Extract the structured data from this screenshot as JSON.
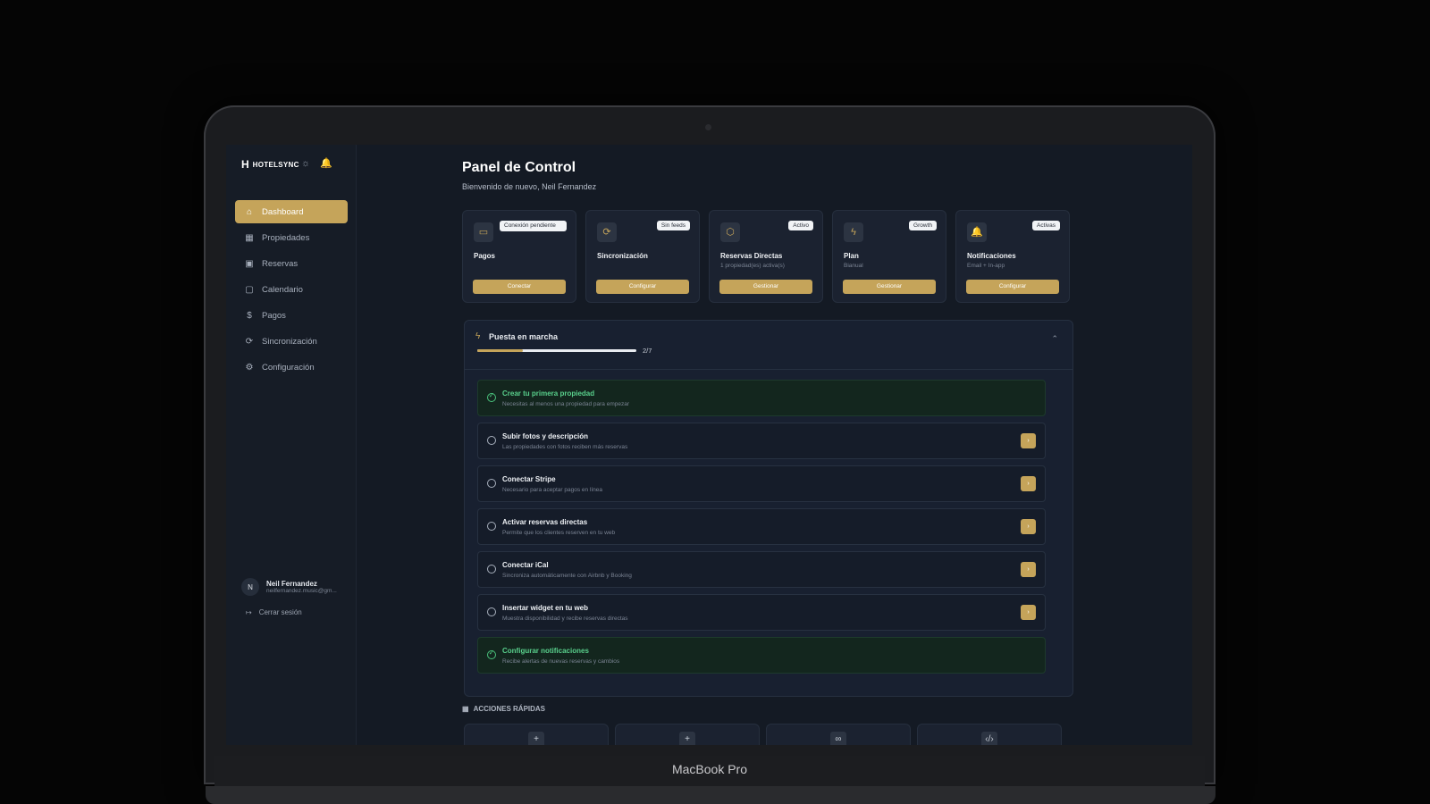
{
  "device": {
    "label": "MacBook Pro"
  },
  "brand": {
    "logo": "H",
    "name": "HOTELSYNC"
  },
  "icons": {
    "theme": "sun-icon",
    "notifications": "bell-icon"
  },
  "nav": [
    {
      "label": "Dashboard",
      "icon": "home-icon",
      "active": true
    },
    {
      "label": "Propiedades",
      "icon": "building-icon"
    },
    {
      "label": "Reservas",
      "icon": "calendar-check-icon"
    },
    {
      "label": "Calendario",
      "icon": "calendar-icon"
    },
    {
      "label": "Pagos",
      "icon": "dollar-icon"
    },
    {
      "label": "Sincronización",
      "icon": "sync-icon"
    },
    {
      "label": "Configuración",
      "icon": "gear-icon"
    }
  ],
  "user": {
    "initial": "N",
    "name": "Neil Fernandez",
    "email": "neilfernandez.music@gm..."
  },
  "logout": {
    "label": "Cerrar sesión"
  },
  "page": {
    "title": "Panel de Control",
    "subtitle": "Bienvenido de nuevo, Neil Fernandez"
  },
  "cards": [
    {
      "title": "Pagos",
      "subtitle": "",
      "badge": "Conexión pendiente",
      "button": "Conectar",
      "icon": "card-icon"
    },
    {
      "title": "Sincronización",
      "subtitle": "",
      "badge": "Sin feeds",
      "button": "Configurar",
      "icon": "sync-icon"
    },
    {
      "title": "Reservas Directas",
      "subtitle": "1 propiedad(es) activa(s)",
      "badge": "Activo",
      "button": "Gestionar",
      "icon": "cube-icon"
    },
    {
      "title": "Plan",
      "subtitle": "Bianual",
      "badge": "Growth",
      "button": "Gestionar",
      "icon": "bolt-icon"
    },
    {
      "title": "Notificaciones",
      "subtitle": "Email + In-app",
      "badge": "Activas",
      "button": "Configurar",
      "icon": "bell-icon"
    }
  ],
  "onboarding": {
    "title": "Puesta en marcha",
    "progress_label": "2/7",
    "progress_fraction": 0.2857,
    "tasks": [
      {
        "title": "Crear tu primera propiedad",
        "desc": "Necesitas al menos una propiedad para empezar",
        "done": true
      },
      {
        "title": "Subir fotos y descripción",
        "desc": "Las propiedades con fotos reciben más reservas",
        "done": false
      },
      {
        "title": "Conectar Stripe",
        "desc": "Necesario para aceptar pagos en línea",
        "done": false
      },
      {
        "title": "Activar reservas directas",
        "desc": "Permite que los clientes reserven en tu web",
        "done": false
      },
      {
        "title": "Conectar iCal",
        "desc": "Sincroniza automáticamente con Airbnb y Booking",
        "done": false
      },
      {
        "title": "Insertar widget en tu web",
        "desc": "Muestra disponibilidad y recibe reservas directas",
        "done": false
      },
      {
        "title": "Configurar notificaciones",
        "desc": "Recibe alertas de nuevas reservas y cambios",
        "done": true
      }
    ]
  },
  "quick_actions": {
    "title": "ACCIONES RÁPIDAS",
    "items": [
      {
        "icon": "plus-icon"
      },
      {
        "icon": "plus-icon"
      },
      {
        "icon": "link-icon"
      },
      {
        "icon": "code-icon"
      }
    ]
  },
  "colors": {
    "accent": "#c5a45a",
    "success": "#4ac27c",
    "background": "#141a24"
  }
}
